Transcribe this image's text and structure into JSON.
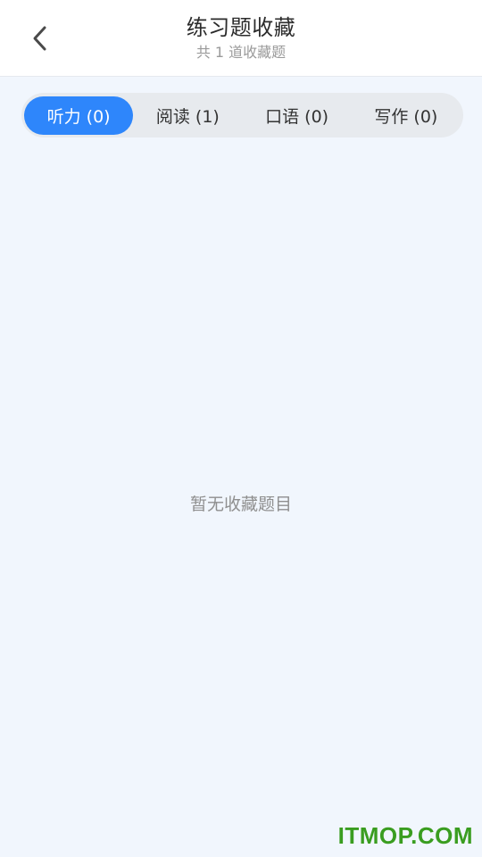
{
  "header": {
    "back_icon": "chevron-left-icon",
    "title": "练习题收藏",
    "subtitle": "共 1 道收藏题"
  },
  "tabs": [
    {
      "label": "听力 (0)",
      "active": true
    },
    {
      "label": "阅读 (1)",
      "active": false
    },
    {
      "label": "口语 (0)",
      "active": false
    },
    {
      "label": "写作 (0)",
      "active": false
    }
  ],
  "empty_state": {
    "message": "暂无收藏题目"
  },
  "watermark": {
    "text": "ITMOP.COM"
  },
  "colors": {
    "accent": "#2e86fb",
    "background": "#f1f6fd",
    "tab_bar": "#e7eaee",
    "watermark": "#3a9d20"
  }
}
